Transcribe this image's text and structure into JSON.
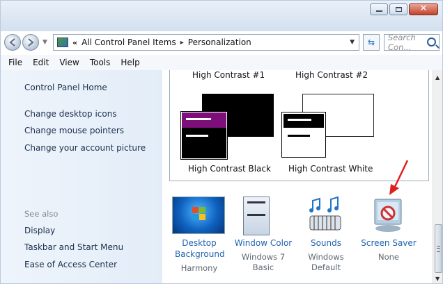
{
  "address": {
    "crumbs": [
      "All Control Panel Items",
      "Personalization"
    ],
    "overflow_chevron": "«",
    "separator": "▸",
    "search_placeholder": "Search Con..."
  },
  "menu": [
    "File",
    "Edit",
    "View",
    "Tools",
    "Help"
  ],
  "sidebar": {
    "home": "Control Panel Home",
    "links": [
      "Change desktop icons",
      "Change mouse pointers",
      "Change your account picture"
    ],
    "see_also_title": "See also",
    "see_also": [
      "Display",
      "Taskbar and Start Menu",
      "Ease of Access Center"
    ]
  },
  "themes": {
    "hc1": "High Contrast #1",
    "hc2": "High Contrast #2",
    "hc_black": "High Contrast Black",
    "hc_white": "High Contrast White"
  },
  "settings": {
    "desktop_bg": {
      "label": [
        "Desktop",
        "Background"
      ],
      "sub": [
        "Harmony"
      ]
    },
    "window_color": {
      "label": [
        "Window Color"
      ],
      "sub": [
        "Windows 7",
        "Basic"
      ]
    },
    "sounds": {
      "label": [
        "Sounds"
      ],
      "sub": [
        "Windows",
        "Default"
      ]
    },
    "screen_saver": {
      "label": [
        "Screen Saver"
      ],
      "sub": [
        "None"
      ]
    }
  },
  "icons": {
    "back": "back-arrow-icon",
    "forward": "forward-arrow-icon",
    "refresh": "refresh-icon",
    "search": "search-icon",
    "annotation": "red-arrow-icon"
  },
  "colors": {
    "link": "#1f63b0",
    "annotation": "#e02020",
    "hc_purple": "#7d0f7a"
  }
}
